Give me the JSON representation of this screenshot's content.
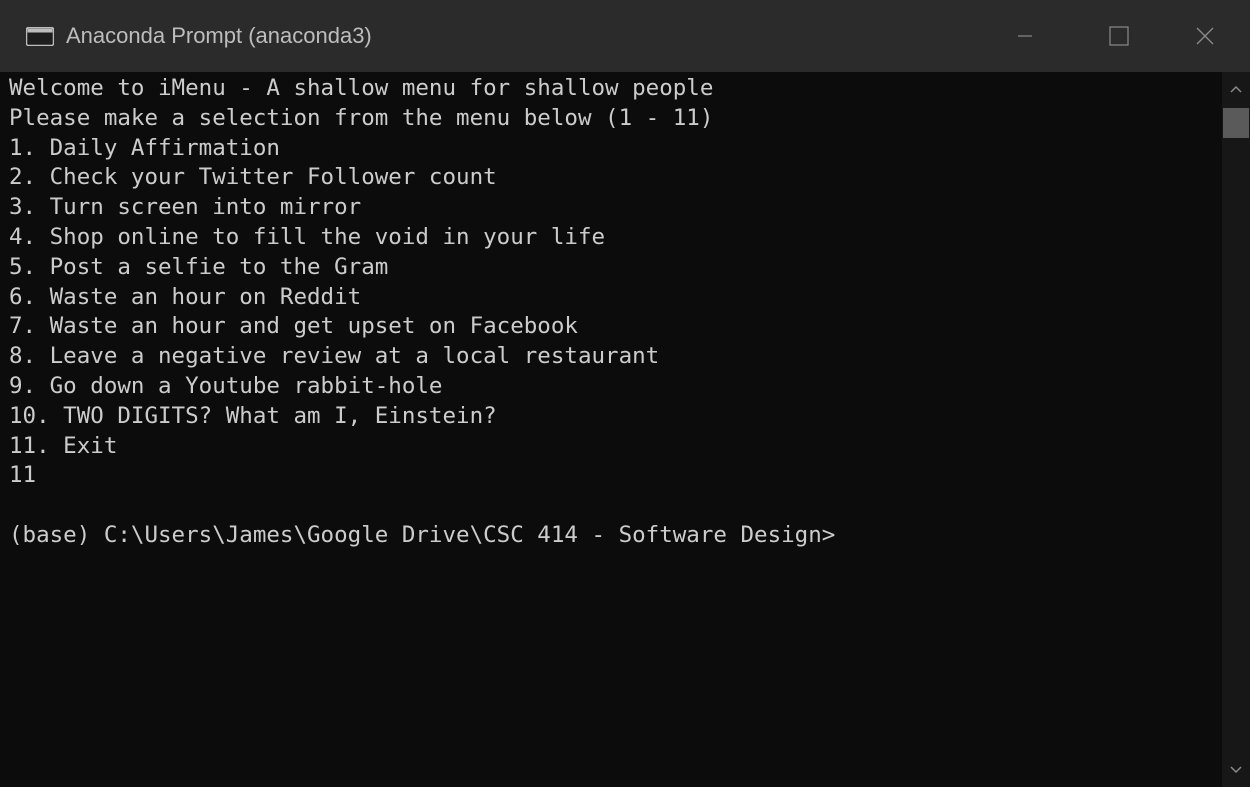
{
  "window": {
    "title": "Anaconda Prompt (anaconda3)",
    "app_icon": "console-icon",
    "controls": {
      "minimize_icon": "minimize-icon",
      "maximize_icon": "maximize-icon",
      "close_icon": "close-icon"
    },
    "colors": {
      "titlebar": "#2b2b2b",
      "background": "#0c0c0c",
      "text": "#cccccc"
    }
  },
  "terminal": {
    "lines": [
      "Welcome to iMenu - A shallow menu for shallow people",
      "Please make a selection from the menu below (1 - 11)",
      "1. Daily Affirmation",
      "2. Check your Twitter Follower count",
      "3. Turn screen into mirror",
      "4. Shop online to fill the void in your life",
      "5. Post a selfie to the Gram",
      "6. Waste an hour on Reddit",
      "7. Waste an hour and get upset on Facebook",
      "8. Leave a negative review at a local restaurant",
      "9. Go down a Youtube rabbit-hole",
      "10. TWO DIGITS? What am I, Einstein?",
      "11. Exit",
      "11",
      "",
      "(base) C:\\Users\\James\\Google Drive\\CSC 414 - Software Design>"
    ]
  },
  "scrollbar": {
    "up_icon": "chevron-up-icon",
    "down_icon": "chevron-down-icon"
  }
}
